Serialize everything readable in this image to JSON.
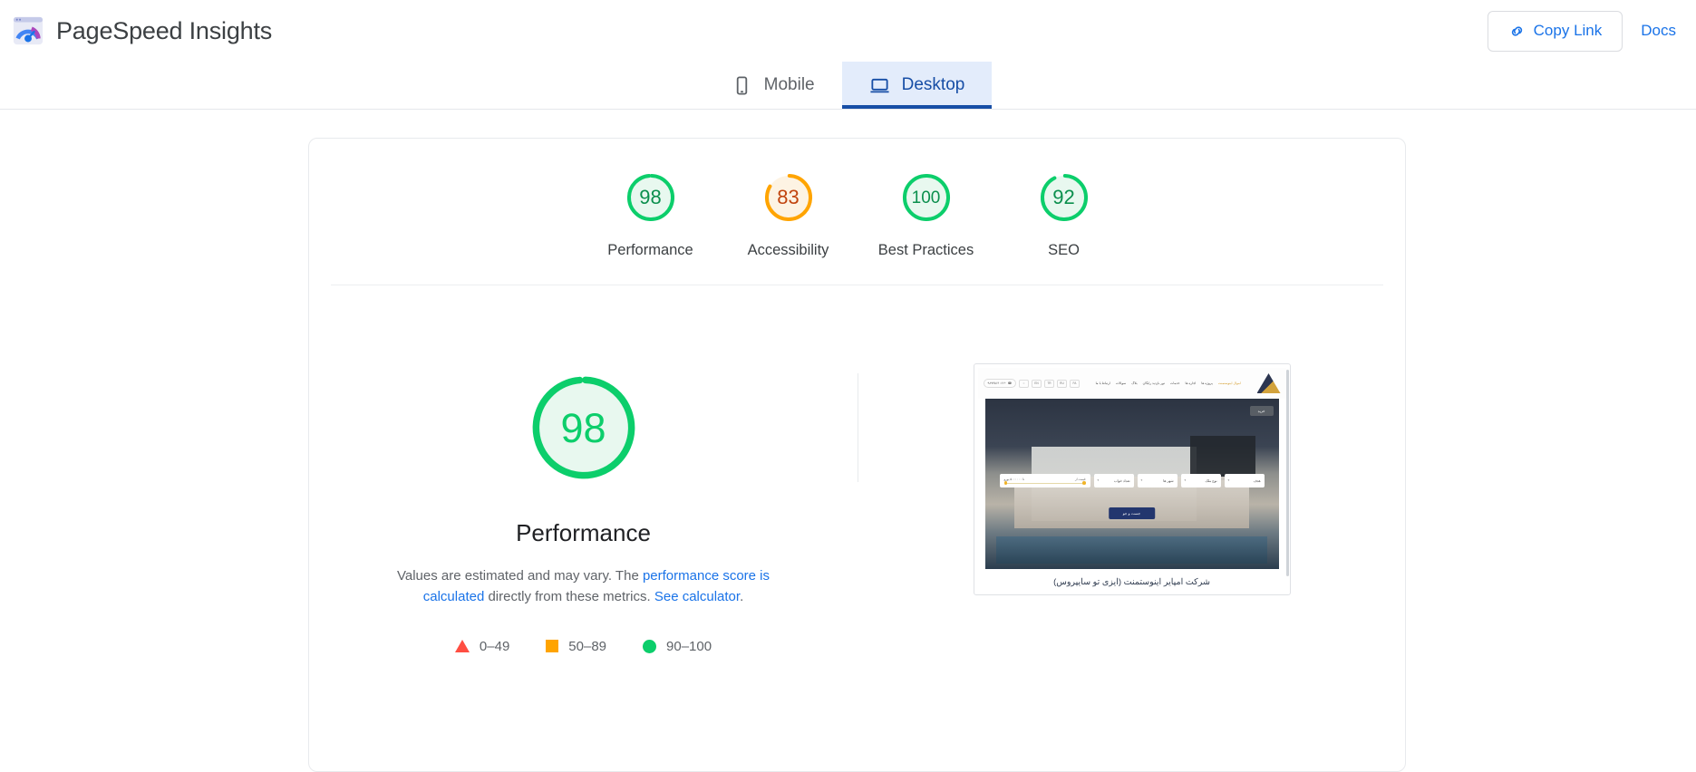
{
  "header": {
    "brand_title": "PageSpeed Insights",
    "logo_icon": "pagespeed-logo",
    "copy_link_label": "Copy Link",
    "copy_link_icon": "link-icon",
    "docs_label": "Docs"
  },
  "tabs": [
    {
      "label": "Mobile",
      "icon": "mobile-phone-icon",
      "active": false
    },
    {
      "label": "Desktop",
      "icon": "desktop-monitor-icon",
      "active": true
    }
  ],
  "summary_gauges": [
    {
      "label": "Performance",
      "score": "98",
      "value": 98,
      "color": "#0cce6b",
      "fill": "#e8f8ef",
      "text_color": "#0b8f4d"
    },
    {
      "label": "Accessibility",
      "score": "83",
      "value": 83,
      "color": "#ffa400",
      "fill": "#fdf3e3",
      "text_color": "#c1440e"
    },
    {
      "label": "Best Practices",
      "score": "100",
      "value": 100,
      "color": "#0cce6b",
      "fill": "#e8f8ef",
      "text_color": "#0b8f4d"
    },
    {
      "label": "SEO",
      "score": "92",
      "value": 92,
      "color": "#0cce6b",
      "fill": "#e8f8ef",
      "text_color": "#0b8f4d"
    }
  ],
  "category": {
    "score": "98",
    "value": 98,
    "title": "Performance",
    "color": "#0cce6b",
    "fill": "#e8f8ef",
    "desc_part1": "Values are estimated and may vary. The ",
    "desc_link1": "performance score is calculated",
    "desc_part2": " directly from these metrics. ",
    "desc_link2": "See calculator",
    "desc_part3": "."
  },
  "legend": [
    {
      "shape": "triangle",
      "label": "0–49",
      "color": "#ff4e42"
    },
    {
      "shape": "square",
      "label": "50–89",
      "color": "#ffa400"
    },
    {
      "shape": "circle",
      "label": "90–100",
      "color": "#0cce6b"
    }
  ],
  "thumbnail": {
    "caption": "شرکت امپایر اینوستمنت (ایزی تو سایپروس)",
    "phone": "+۹۸۹۳۵۱۴۰۶۶",
    "nav_chips": [
      "EN",
      "TR",
      "RU",
      "FA"
    ],
    "nav_links": [
      "ارتباط با ما",
      "سوالات",
      "بلاگ",
      "تور بازدید رایگان",
      "خدمات",
      "اجاره ها",
      "پروژه ها"
    ],
    "nav_link_hot": "اموال اینوستمنت",
    "buy_button": "خرید",
    "filters": [
      {
        "label": "هدف"
      },
      {
        "label": "نوع ملک"
      },
      {
        "label": "شهر ها"
      },
      {
        "label": "تعداد خواب"
      }
    ],
    "price_label": "قیمت از",
    "price_range": "تا ۵۰۰۰۰۰۰ یورو",
    "search_button": "جست و جو"
  }
}
